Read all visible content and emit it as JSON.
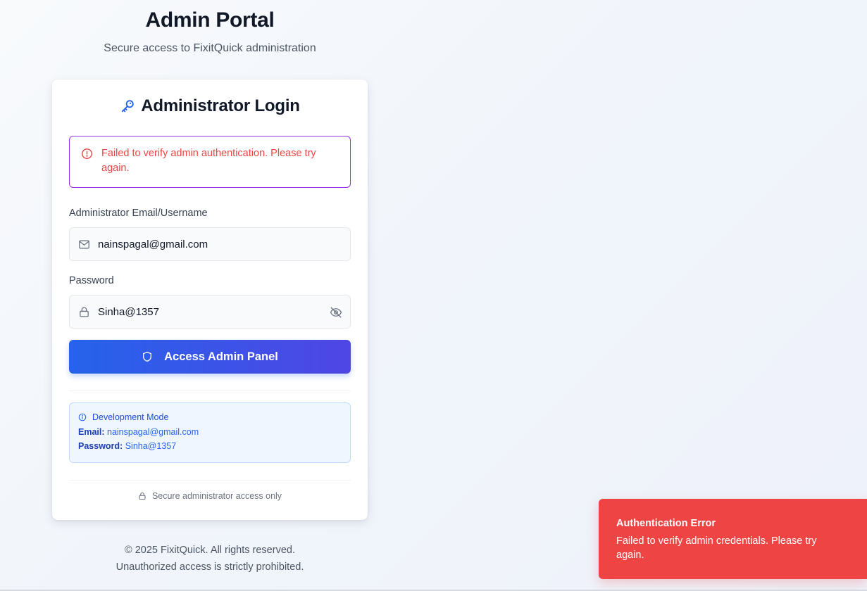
{
  "header": {
    "title": "Admin Portal",
    "subtitle": "Secure access to FixitQuick administration"
  },
  "login_card": {
    "title": "Administrator Login",
    "title_icon": "key-icon",
    "error_message": "Failed to verify admin authentication. Please try again.",
    "email_field": {
      "label": "Administrator Email/Username",
      "value": "nainspagal@gmail.com",
      "icon": "mail-icon"
    },
    "password_field": {
      "label": "Password",
      "value": "Sinha@1357",
      "icon": "lock-icon",
      "toggle_icon": "eye-off-icon"
    },
    "submit_label": "Access Admin Panel",
    "submit_icon": "shield-icon",
    "dev_mode": {
      "heading": "Development Mode",
      "email_label": "Email:",
      "email_value": "nainspagal@gmail.com",
      "password_label": "Password:",
      "password_value": "Sinha@1357"
    },
    "secure_note": "Secure administrator access only"
  },
  "footer": {
    "copyright": "© 2025 FixitQuick. All rights reserved.",
    "warning": "Unauthorized access is strictly prohibited."
  },
  "toast": {
    "title": "Authentication Error",
    "message": "Failed to verify admin credentials. Please try again."
  },
  "colors": {
    "primary": "#2563eb",
    "primary_end": "#4f46e5",
    "error": "#ef4444",
    "error_border": "#9333ea",
    "info_bg": "#eff6ff"
  }
}
